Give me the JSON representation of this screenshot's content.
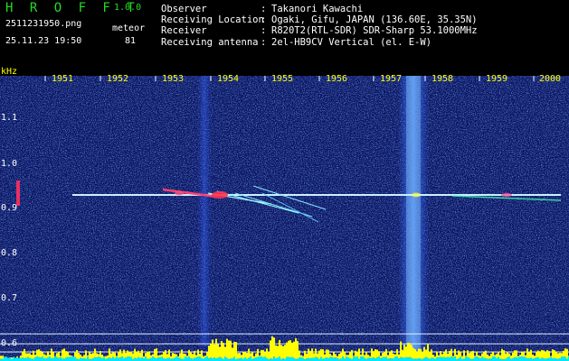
{
  "header": {
    "app_title": "H R O F F T",
    "app_version": "1.0.0",
    "file_name": "2511231950.png",
    "timestamp": "25.11.23 19:50",
    "mode_label": "meteor",
    "count_value": "81",
    "info_rows": [
      {
        "key": "Observer",
        "sep": ":",
        "value": "Takanori Kawachi"
      },
      {
        "key": "Receiving Location",
        "sep": ":",
        "value": "Ogaki, Gifu, JAPAN (136.60E, 35.35N)"
      },
      {
        "key": "Receiver",
        "sep": ":",
        "value": "R820T2(RTL-SDR) SDR-Sharp 53.1000MHz"
      },
      {
        "key": "Receiving antenna",
        "sep": ":",
        "value": "2el-HB9CV Vertical (el. E-W)"
      }
    ]
  },
  "axis": {
    "unit_label": "kHz",
    "x_ticks": [
      "1951",
      "1952",
      "1953",
      "1954",
      "1955",
      "1956",
      "1957",
      "1958",
      "1959",
      "2000"
    ],
    "y_ticks": [
      "1.1",
      "1.0",
      "0.9",
      "0.8",
      "0.7",
      "0.6"
    ]
  },
  "colors": {
    "background": "#000000",
    "title_green": "#22dd22",
    "axis_yellow": "#ffff00",
    "carrier_line": "#c8f0ff",
    "noise_blue": "#1a3cff",
    "spectrum_yellow": "#ffff00",
    "spectrum_cyan": "#00e8ff"
  }
}
